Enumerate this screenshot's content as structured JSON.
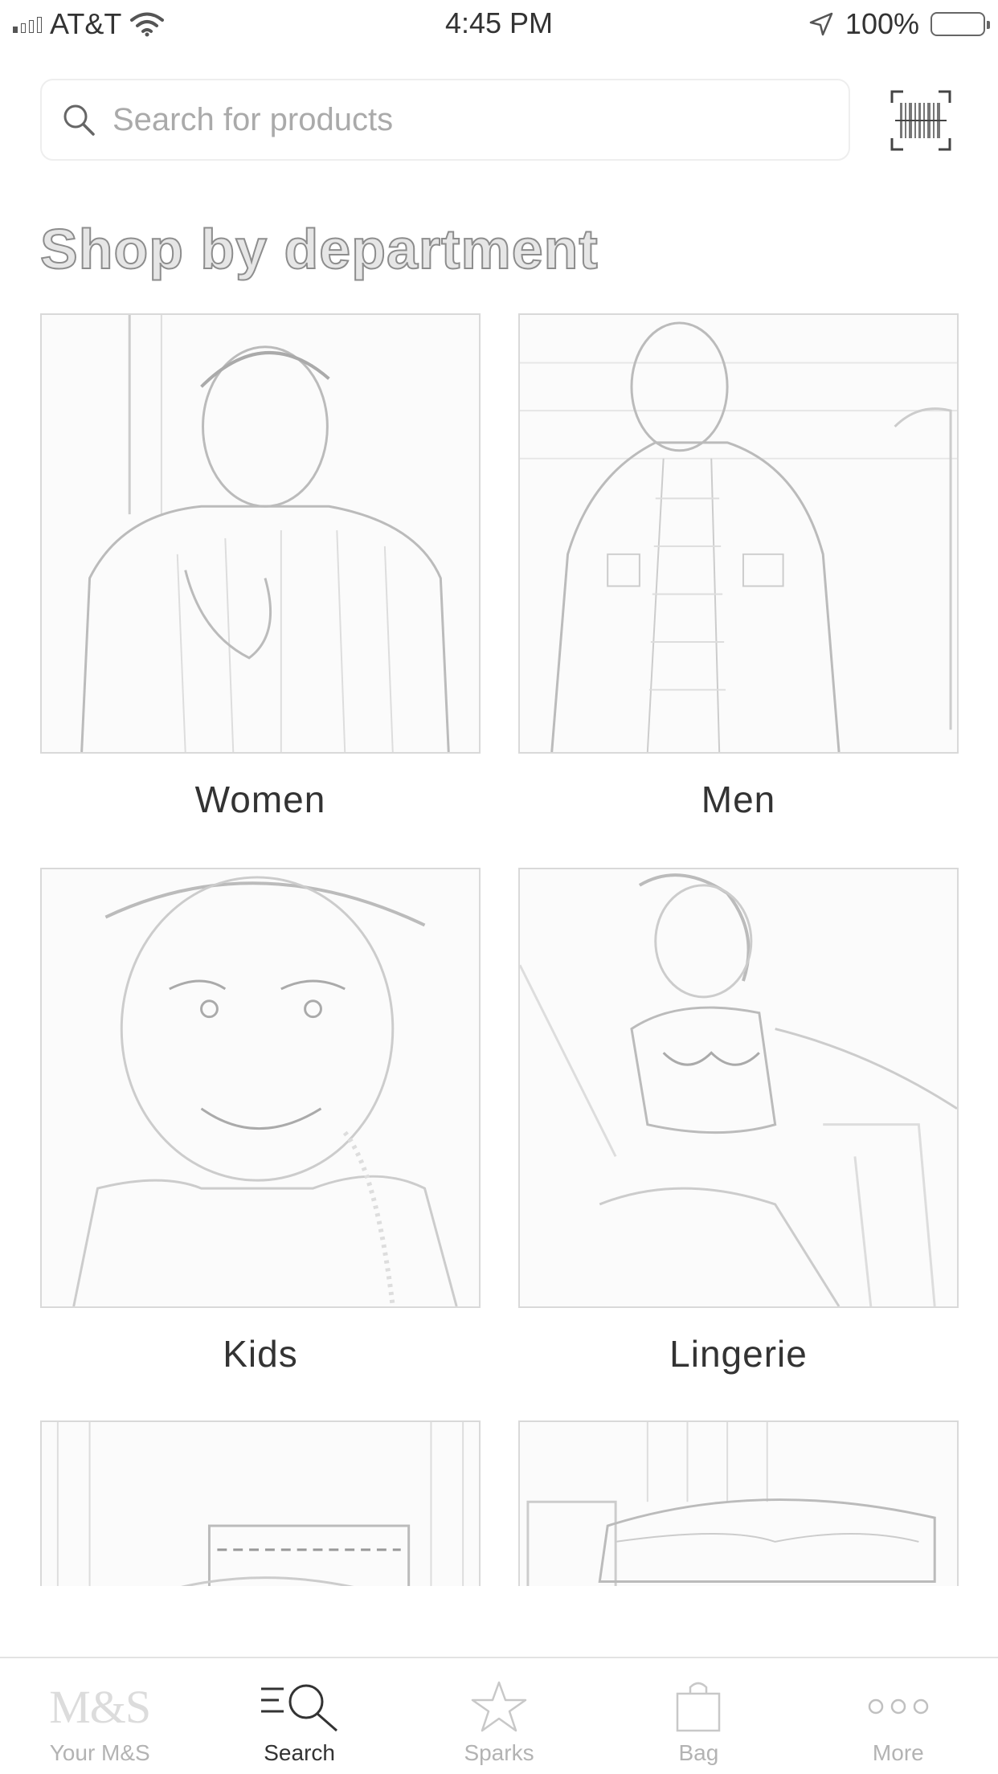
{
  "status_bar": {
    "carrier": "AT&T",
    "time": "4:45 PM",
    "battery": "100%",
    "battery_level": 1.0
  },
  "search": {
    "placeholder": "Search for products"
  },
  "section_title": "Shop by department",
  "departments": [
    {
      "label": "Women"
    },
    {
      "label": "Men"
    },
    {
      "label": "Kids"
    },
    {
      "label": "Lingerie"
    },
    {
      "label": ""
    },
    {
      "label": ""
    }
  ],
  "tab_bar": {
    "tabs": [
      {
        "logo": "M&S",
        "label": "Your M&S",
        "icon": "ms-logo-icon"
      },
      {
        "label": "Search",
        "icon": "search-list-icon",
        "active": true
      },
      {
        "label": "Sparks",
        "icon": "star-icon"
      },
      {
        "label": "Bag",
        "icon": "bag-icon"
      },
      {
        "label": "More",
        "icon": "more-dots-icon"
      }
    ]
  },
  "colors": {
    "text": "#333333",
    "muted": "#b3b3b3",
    "border": "#d9d9d9"
  }
}
